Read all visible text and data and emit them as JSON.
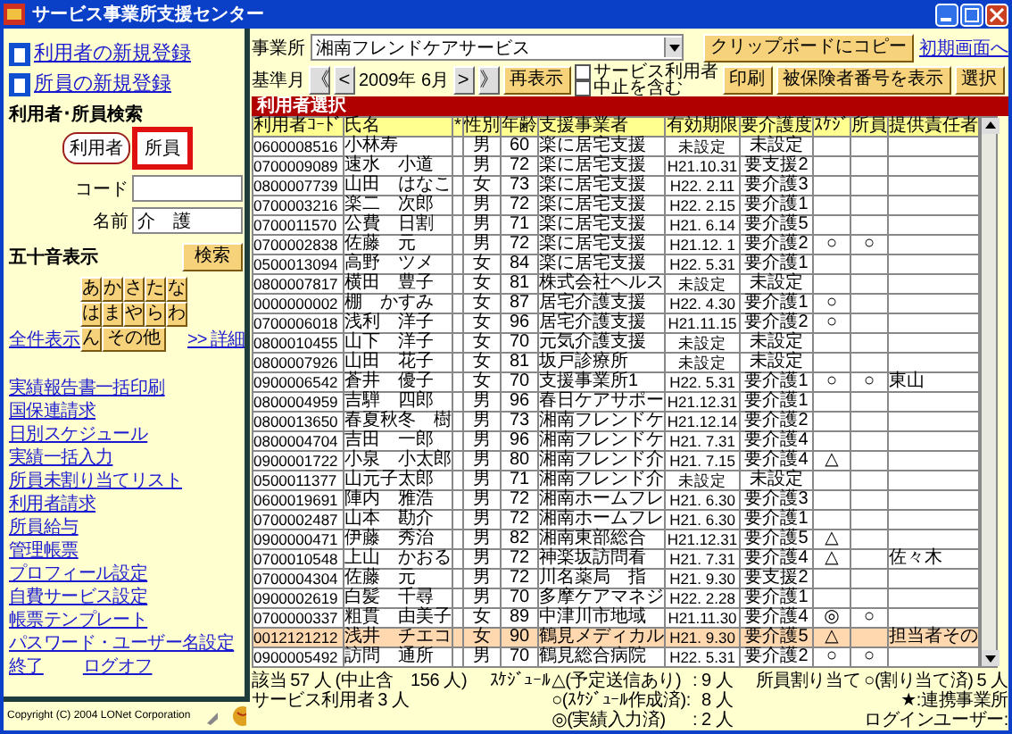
{
  "window": {
    "title": "サービス事業所支援センター"
  },
  "sidebar": {
    "register_links": [
      "利用者の新規登録",
      "所員の新規登録"
    ],
    "search": {
      "title": "利用者･所員検索",
      "options": [
        {
          "label": "利用者",
          "selected": true,
          "highlighted": false
        },
        {
          "label": "所員",
          "selected": false,
          "highlighted": true
        }
      ],
      "code_label": "コード",
      "name_label": "名前",
      "name_value": "介　護"
    },
    "kana": {
      "title": "五十音表示",
      "search_button": "検索",
      "keys": [
        "あ",
        "か",
        "さ",
        "た",
        "な",
        "は",
        "ま",
        "や",
        "ら",
        "わ",
        "ん",
        "その他"
      ],
      "show_all": "全件表示",
      "details": ">> 詳細"
    },
    "links": [
      "実績報告書一括印刷",
      "国保連請求",
      "日別スケジュール",
      "実績一括入力",
      "所員未割り当てリスト",
      "利用者請求",
      "所員給与",
      "管理帳票",
      "プロフィール設定",
      "自費サービス設定",
      "帳票テンプレート",
      "パスワード・ユーザー名設定"
    ],
    "bottom_links": [
      "終了",
      "ログオフ"
    ],
    "copyright": "Copyright (C) 2004 LONet Corporation"
  },
  "toolbar": {
    "office_label": "事業所",
    "office": "湘南フレンドケアサービス",
    "clipboard_button": "クリップボードにコピー",
    "home_link": "初期画面へ",
    "month_label": "基準月",
    "first": "《",
    "prev": "<",
    "month": "2009年 6月",
    "next": ">",
    "last": "》",
    "refresh": "再表示",
    "checkboxes": [
      {
        "label": "サービス利用者",
        "checked": false
      },
      {
        "label": "中止を含む",
        "checked": false
      }
    ],
    "print": "印刷",
    "insured_button": "被保険者番号を表示",
    "select_button": "選択"
  },
  "section_title": "利用者選択",
  "table": {
    "columns": [
      "利用者ｺｰﾄﾞ",
      "氏名",
      "*",
      "性別",
      "年齢",
      "支援事業者",
      "有効期限",
      "要介護度",
      "ｽｹｼﾞ",
      "所員",
      "提供責任者"
    ],
    "rows": [
      {
        "code": "0600008516",
        "name": "小林寿",
        "sex": "男",
        "age": "60",
        "provider": "楽に居宅支援",
        "expiry": "未設定",
        "care": "未設定",
        "selected": false
      },
      {
        "code": "0700009089",
        "name": "速水　小道",
        "sex": "男",
        "age": "72",
        "provider": "楽に居宅支援",
        "expiry": "H21.10.31",
        "care": "要支援2",
        "selected": false
      },
      {
        "code": "0800007739",
        "name": "山田　はなこ",
        "sex": "女",
        "age": "73",
        "provider": "楽に居宅支援",
        "expiry": "H22. 2.11",
        "care": "要介護3",
        "selected": false
      },
      {
        "code": "0700003216",
        "name": "楽二　次郎",
        "sex": "男",
        "age": "72",
        "provider": "楽に居宅支援",
        "expiry": "H22. 2.15",
        "care": "要介護1",
        "selected": false
      },
      {
        "code": "0700011570",
        "name": "公費　日割",
        "sex": "男",
        "age": "71",
        "provider": "楽に居宅支援",
        "expiry": "H21. 6.14",
        "care": "要介護5",
        "selected": false
      },
      {
        "code": "0700002838",
        "name": "佐藤　元",
        "sex": "男",
        "age": "72",
        "provider": "楽に居宅支援",
        "expiry": "H21.12. 1",
        "care": "要介護2",
        "schedule": "○",
        "staff": "○",
        "selected": false
      },
      {
        "code": "0500013094",
        "name": "高野　ツメ",
        "sex": "女",
        "age": "84",
        "provider": "楽に居宅支援",
        "expiry": "H22. 5.31",
        "care": "要介護1",
        "selected": false
      },
      {
        "code": "0800007817",
        "name": "横田　豊子",
        "sex": "女",
        "age": "81",
        "provider": "株式会社ヘルス",
        "expiry": "未設定",
        "care": "未設定",
        "selected": false
      },
      {
        "code": "0000000002",
        "name": "棚　かすみ",
        "sex": "女",
        "age": "87",
        "provider": "居宅介護支援",
        "expiry": "H22. 4.30",
        "care": "要介護1",
        "schedule": "○",
        "selected": false
      },
      {
        "code": "0700006018",
        "name": "浅利　洋子",
        "sex": "女",
        "age": "96",
        "provider": "居宅介護支援",
        "expiry": "H21.11.15",
        "care": "要介護2",
        "schedule": "○",
        "selected": false
      },
      {
        "code": "0800010455",
        "name": "山下　洋子",
        "sex": "女",
        "age": "70",
        "provider": "元気介護支援",
        "expiry": "未設定",
        "care": "未設定",
        "selected": false
      },
      {
        "code": "0800007926",
        "name": "山田　花子",
        "sex": "女",
        "age": "81",
        "provider": "坂戸診療所",
        "expiry": "未設定",
        "care": "未設定",
        "selected": false
      },
      {
        "code": "0900006542",
        "name": "蒼井　優子",
        "sex": "女",
        "age": "70",
        "provider": "支援事業所1",
        "expiry": "H22. 5.31",
        "care": "要介護1",
        "schedule": "○",
        "staff": "○",
        "manager": "東山",
        "selected": false
      },
      {
        "code": "0800004959",
        "name": "吉騨　四郎",
        "sex": "男",
        "age": "96",
        "provider": "春日ケアサポー",
        "expiry": "H21.12.31",
        "care": "要介護1",
        "selected": false
      },
      {
        "code": "0800013650",
        "name": "春夏秋冬　樹",
        "sex": "男",
        "age": "73",
        "provider": "湘南フレンドケ",
        "expiry": "H21.12.14",
        "care": "要介護2",
        "selected": false
      },
      {
        "code": "0800004704",
        "name": "吉田　一郎",
        "sex": "男",
        "age": "96",
        "provider": "湘南フレンドケ",
        "expiry": "H21. 7.31",
        "care": "要介護4",
        "selected": false
      },
      {
        "code": "0900001722",
        "name": "小泉　小太郎",
        "sex": "男",
        "age": "80",
        "provider": "湘南フレンド介",
        "expiry": "H21. 7.15",
        "care": "要介護4",
        "schedule": "△",
        "selected": false
      },
      {
        "code": "0500011377",
        "name": "山元子太郎",
        "sex": "男",
        "age": "71",
        "provider": "湘南フレンド介",
        "expiry": "未設定",
        "care": "未設定",
        "selected": false
      },
      {
        "code": "0600019691",
        "name": "陣内　雅浩",
        "sex": "男",
        "age": "72",
        "provider": "湘南ホームフレ",
        "expiry": "H21. 6.30",
        "care": "要介護3",
        "selected": false
      },
      {
        "code": "0700002487",
        "name": "山本　勘介",
        "sex": "男",
        "age": "72",
        "provider": "湘南ホームフレ",
        "expiry": "H21. 6.30",
        "care": "要介護1",
        "selected": false
      },
      {
        "code": "0900000471",
        "name": "伊藤　秀治",
        "sex": "男",
        "age": "82",
        "provider": "湘南東部総合",
        "expiry": "H21.12.31",
        "care": "要介護5",
        "schedule": "△",
        "selected": false
      },
      {
        "code": "0700010548",
        "name": "上山　かおる",
        "sex": "男",
        "age": "72",
        "provider": "神楽坂訪問看",
        "expiry": "H21. 7.31",
        "care": "要介護4",
        "schedule": "△",
        "manager": "佐々木",
        "selected": false
      },
      {
        "code": "0700004304",
        "name": "佐藤　元",
        "sex": "男",
        "age": "72",
        "provider": "川名薬局　指",
        "expiry": "H21. 9.30",
        "care": "要支援2",
        "selected": false
      },
      {
        "code": "0900002619",
        "name": "白髪　千尋",
        "sex": "男",
        "age": "70",
        "provider": "多摩ケアマネジ",
        "expiry": "H22. 2.28",
        "care": "要介護1",
        "selected": false
      },
      {
        "code": "0700000337",
        "name": "粗貫　由美子",
        "sex": "女",
        "age": "89",
        "provider": "中津川市地域",
        "expiry": "H21.11.30",
        "care": "要介護4",
        "schedule": "◎",
        "staff": "○",
        "selected": false
      },
      {
        "code": "0012121212",
        "name": "浅井　チエコ",
        "sex": "女",
        "age": "90",
        "provider": "鶴見メディカル",
        "expiry": "H21. 9.30",
        "care": "要介護5",
        "schedule": "△",
        "manager": "担当者その",
        "selected": true
      },
      {
        "code": "0900005492",
        "name": "訪問　通所",
        "sex": "男",
        "age": "70",
        "provider": "鶴見総合病院",
        "expiry": "H22. 5.31",
        "care": "要介護2",
        "schedule": "○",
        "staff": "○",
        "selected": false
      }
    ]
  },
  "footer": {
    "total_label": "該当",
    "total": "57 人",
    "cancelled": "(中止含　156 人)",
    "users_label": "サービス利用者",
    "users": "3 人",
    "schedule_label": "ｽｹｼﾞｭｰﾙ",
    "legend": [
      {
        "label": "△(予定送信あり)",
        "sep": ":",
        "count": "9 人"
      },
      {
        "label": "○(ｽｹｼﾞｭｰﾙ作成済):",
        "count": "8 人"
      },
      {
        "label": "◎(実績入力済)",
        "sep": ":",
        "count": "2 人"
      }
    ],
    "staff_label": "所員割り当て",
    "staff_legend": "○(割り当て済)",
    "staff_count": "5 人",
    "partner_note": "★:連携事業所",
    "login_label": "ログインユーザー:"
  }
}
